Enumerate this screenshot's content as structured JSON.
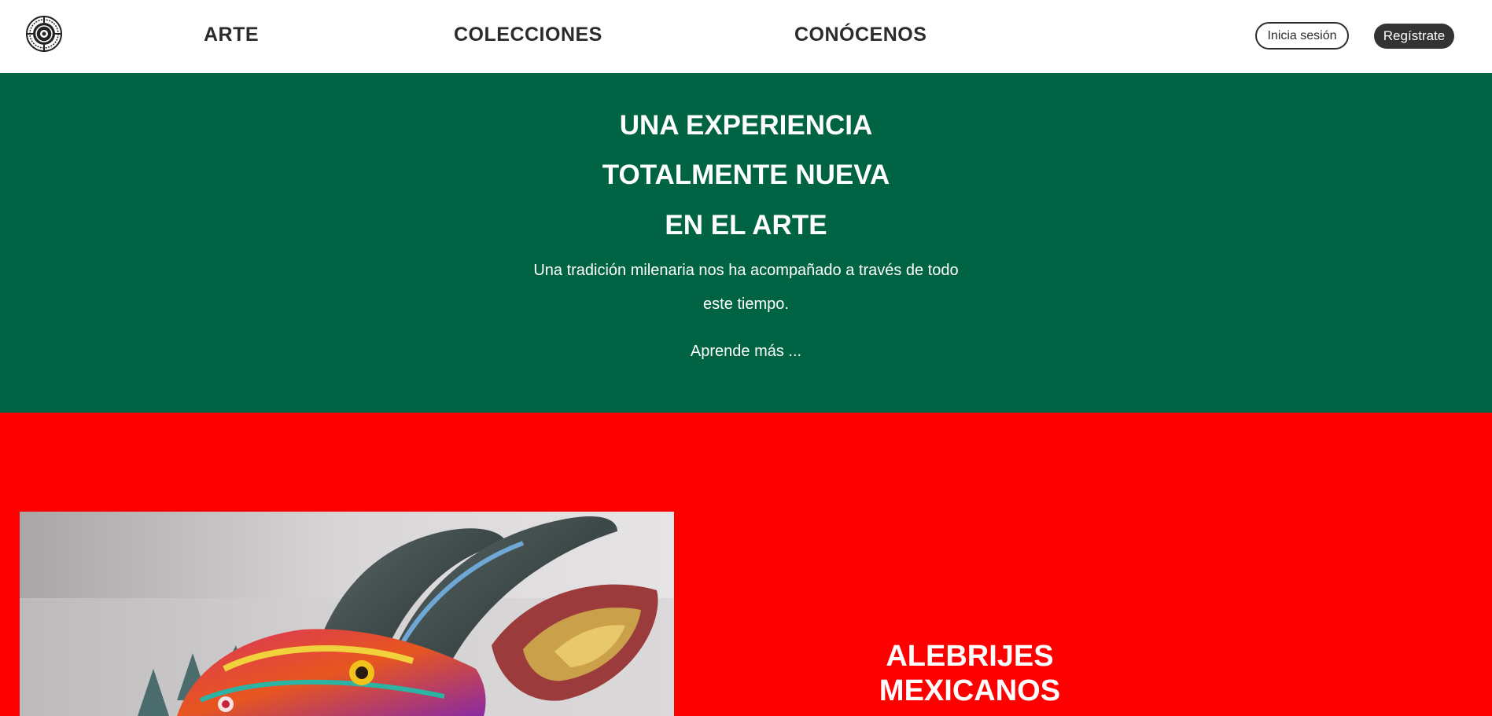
{
  "nav": {
    "logo_icon": "aztec-calendar-icon",
    "links": [
      "ARTE",
      "COLECCIONES",
      "CONÓCENOS"
    ],
    "login_label": "Inicia sesión",
    "signup_label": "Regístrate"
  },
  "hero": {
    "title_lines": [
      "UNA EXPERIENCIA",
      "TOTALMENTE NUEVA",
      "EN EL ARTE"
    ],
    "description": "Una tradición milenaria nos ha acompañado a través de todo este tiempo.",
    "link_label": "Aprende más ..."
  },
  "section": {
    "title_lines": [
      "ALEBRIJES",
      "MEXICANOS"
    ],
    "image": "alebrije-sculpture"
  },
  "colors": {
    "header_bg": "#ffffff",
    "hero_bg": "#006444",
    "section_bg": "#ff0000",
    "signup_bg": "#333333",
    "text_dark": "#2b2b2b"
  }
}
